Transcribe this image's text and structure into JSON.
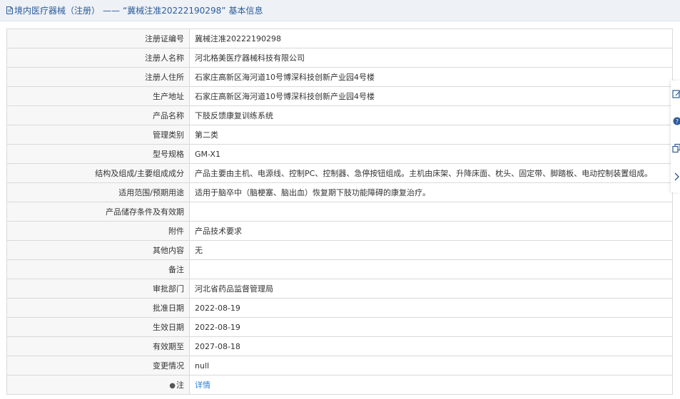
{
  "header": {
    "category": "境内医疗器械（注册）",
    "separator": "——",
    "title": "“冀械注准20222190298”",
    "suffix": "基本信息"
  },
  "rows": [
    {
      "label": "注册证编号",
      "value": "冀械注准20222190298"
    },
    {
      "label": "注册人名称",
      "value": "河北格美医疗器械科技有限公司"
    },
    {
      "label": "注册人住所",
      "value": "石家庄高新区海河道10号博深科技创新产业园4号楼"
    },
    {
      "label": "生产地址",
      "value": "石家庄高新区海河道10号博深科技创新产业园4号楼"
    },
    {
      "label": "产品名称",
      "value": "下肢反馈康复训练系统"
    },
    {
      "label": "管理类别",
      "value": "第二类"
    },
    {
      "label": "型号规格",
      "value": "GM-X1"
    },
    {
      "label": "结构及组成/主要组成成分",
      "value": "产品主要由主机、电源线、控制PC、控制器、急停按钮组成。主机由床架、升降床面、枕头、固定带、脚踏板、电动控制装置组成。"
    },
    {
      "label": "适用范围/预期用途",
      "value": "适用于脑卒中（脑梗塞、脑出血）恢复期下肢功能障碍的康复治疗。"
    },
    {
      "label": "产品储存条件及有效期",
      "value": ""
    },
    {
      "label": "附件",
      "value": "产品技术要求"
    },
    {
      "label": "其他内容",
      "value": "无"
    },
    {
      "label": "备注",
      "value": ""
    },
    {
      "label": "审批部门",
      "value": "河北省药品监督管理局"
    },
    {
      "label": "批准日期",
      "value": "2022-08-19"
    },
    {
      "label": "生效日期",
      "value": "2022-08-19"
    },
    {
      "label": "有效期至",
      "value": "2027-08-18"
    },
    {
      "label": "变更情况",
      "value": "null"
    }
  ],
  "note_row": {
    "label": "注",
    "link": "详情"
  },
  "side_tools": [
    "edit-icon",
    "help-icon",
    "copy-icon",
    "chevron-right-icon"
  ]
}
